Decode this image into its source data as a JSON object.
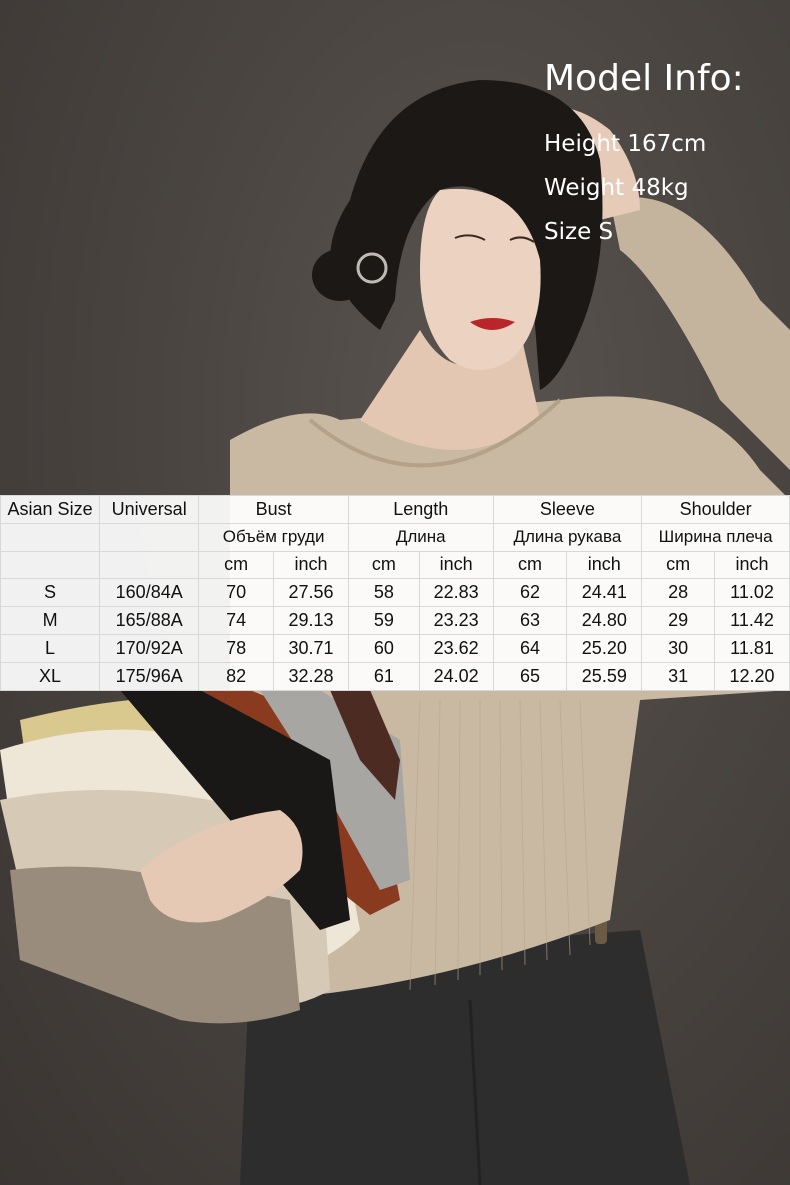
{
  "model_info": {
    "title": "Model Info:",
    "height": "Height 167cm",
    "weight": "Weight 48kg",
    "size": "Size S"
  },
  "size_table": {
    "headers": {
      "asian_size": "Asian Size",
      "universal": "Universal",
      "bust": "Bust",
      "length": "Length",
      "sleeve": "Sleeve",
      "shoulder": "Shoulder"
    },
    "headers_ru": {
      "bust": "Объём груди",
      "length": "Длина",
      "sleeve": "Длина рукава",
      "shoulder": "Ширина плеча"
    },
    "units": [
      "cm",
      "inch",
      "cm",
      "inch",
      "cm",
      "inch",
      "cm",
      "inch"
    ],
    "rows": [
      [
        "S",
        "160/84A",
        "70",
        "27.56",
        "58",
        "22.83",
        "62",
        "24.41",
        "28",
        "11.02"
      ],
      [
        "M",
        "165/88A",
        "74",
        "29.13",
        "59",
        "23.23",
        "63",
        "24.80",
        "29",
        "11.42"
      ],
      [
        "L",
        "170/92A",
        "78",
        "30.71",
        "60",
        "23.62",
        "64",
        "25.20",
        "30",
        "11.81"
      ],
      [
        "XL",
        "175/96A",
        "82",
        "32.28",
        "61",
        "24.02",
        "65",
        "25.59",
        "31",
        "12.20"
      ]
    ]
  }
}
